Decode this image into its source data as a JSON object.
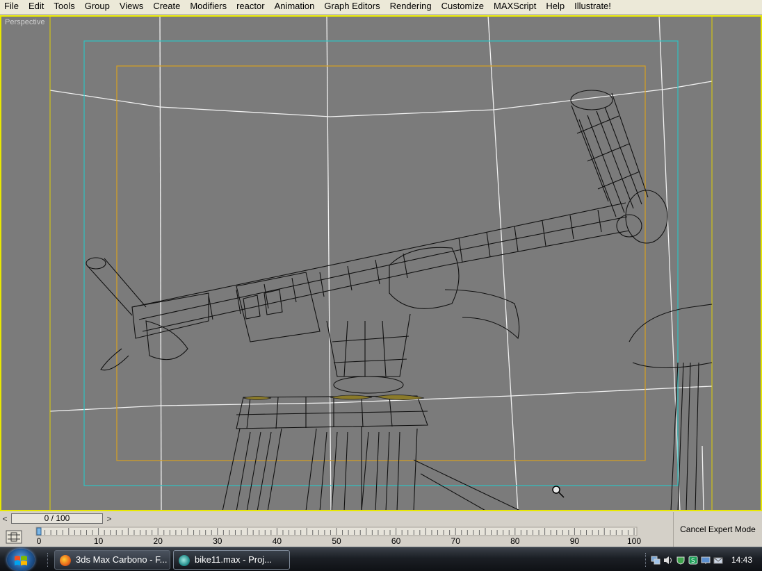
{
  "menu": {
    "items": [
      "File",
      "Edit",
      "Tools",
      "Group",
      "Views",
      "Create",
      "Modifiers",
      "reactor",
      "Animation",
      "Graph Editors",
      "Rendering",
      "Customize",
      "MAXScript",
      "Help",
      "Illustrate!"
    ]
  },
  "viewport": {
    "label": "Perspective",
    "border_color": "#e8e800",
    "safe_frame_color": "#2ec4c4",
    "title_safe_color": "#d8a020",
    "background_color": "#7b7b7b"
  },
  "time_slider": {
    "value": "0 / 100",
    "prev_glyph": "<",
    "next_glyph": ">"
  },
  "track_bar": {
    "ticks": [
      "0",
      "10",
      "20",
      "30",
      "40",
      "50",
      "60",
      "70",
      "80",
      "90",
      "100"
    ]
  },
  "expert_mode": {
    "label": "Cancel Expert Mode"
  },
  "taskbar": {
    "buttons": [
      {
        "label": "3ds Max Carbono - F..."
      },
      {
        "label": "bike11.max     - Proj..."
      }
    ],
    "clock": "14:43"
  }
}
